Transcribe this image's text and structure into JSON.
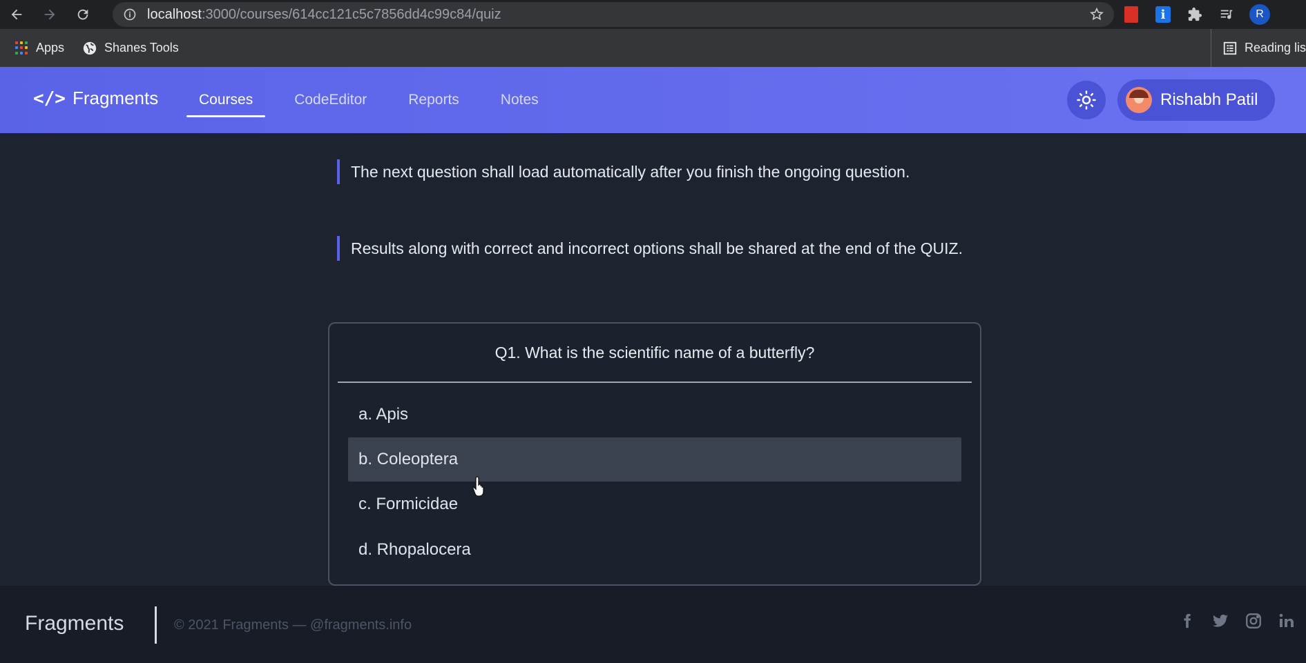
{
  "browser": {
    "url_host": "localhost",
    "url_path": ":3000/courses/614cc121c5c7856dd4c99c84/quiz",
    "profile_initial": "R",
    "bookmarks": [
      {
        "label": "Apps",
        "icon": "apps-grid-icon"
      },
      {
        "label": "Shanes Tools",
        "icon": "globe-icon"
      }
    ],
    "reading_list_label": "Reading lis"
  },
  "navbar": {
    "brand": "Fragments",
    "brand_icon": "</>",
    "links": [
      {
        "label": "Courses",
        "active": true
      },
      {
        "label": "CodeEditor",
        "active": false
      },
      {
        "label": "Reports",
        "active": false
      },
      {
        "label": "Notes",
        "active": false
      }
    ],
    "user_name": "Rishabh Patil"
  },
  "instructions": [
    "The next question shall load automatically after you finish the ongoing question.",
    "Results along with correct and incorrect options shall be shared at the end of the QUIZ."
  ],
  "quiz": {
    "question": "Q1. What is the scientific name of a butterfly?",
    "options": [
      {
        "label": "a. Apis",
        "hovered": false
      },
      {
        "label": "b. Coleoptera",
        "hovered": true
      },
      {
        "label": "c. Formicidae",
        "hovered": false
      },
      {
        "label": "d. Rhopalocera",
        "hovered": false
      }
    ]
  },
  "footer": {
    "brand": "Fragments",
    "copyright": "© 2021 Fragments — @fragments.info",
    "social": [
      "facebook-icon",
      "twitter-icon",
      "instagram-icon",
      "linkedin-icon"
    ]
  },
  "colors": {
    "nav_accent": "#5a63e8",
    "content_bg": "#1d2430",
    "footer_bg": "#171c26"
  }
}
